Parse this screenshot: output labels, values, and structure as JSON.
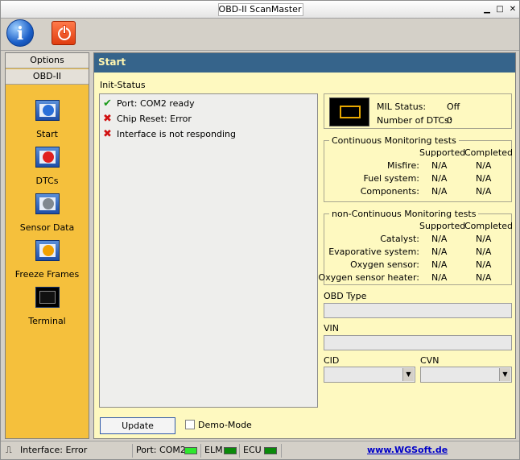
{
  "window": {
    "title": "OBD-II ScanMaster",
    "minimize": "▁",
    "maximize": "□",
    "close": "✕"
  },
  "toolbar": {
    "info_icon": "info-icon",
    "power_icon": "power-icon"
  },
  "sidebar": {
    "tabs": [
      "Options",
      "OBD-II"
    ],
    "items": [
      {
        "label": "Start",
        "icon": "start-info-icon",
        "color": "#2a6fd8"
      },
      {
        "label": "DTCs",
        "icon": "dtc-error-icon",
        "color": "#e02020"
      },
      {
        "label": "Sensor Data",
        "icon": "gear-icon",
        "color": "#808890"
      },
      {
        "label": "Freeze Frames",
        "icon": "freeze-icon",
        "color": "#f0a000"
      },
      {
        "label": "Terminal",
        "icon": "terminal-icon",
        "color": "#000000"
      }
    ]
  },
  "main": {
    "title": "Start",
    "init_status_label": "Init-Status",
    "status_lines": [
      {
        "ok": true,
        "text": "Port: COM2 ready"
      },
      {
        "ok": false,
        "text": "Chip Reset: Error"
      },
      {
        "ok": false,
        "text": "Interface is not responding"
      }
    ],
    "mil": {
      "status_label": "MIL Status:",
      "status_value": "Off",
      "dtc_label": "Number of DTCs:",
      "dtc_value": "0"
    },
    "continuous": {
      "title": "Continuous Monitoring tests",
      "col_supported": "Supported",
      "col_completed": "Completed",
      "rows": [
        {
          "name": "Misfire:",
          "supported": "N/A",
          "completed": "N/A"
        },
        {
          "name": "Fuel system:",
          "supported": "N/A",
          "completed": "N/A"
        },
        {
          "name": "Components:",
          "supported": "N/A",
          "completed": "N/A"
        }
      ]
    },
    "non_continuous": {
      "title": "non-Continuous Monitoring tests",
      "col_supported": "Supported",
      "col_completed": "Completed",
      "rows": [
        {
          "name": "Catalyst:",
          "supported": "N/A",
          "completed": "N/A"
        },
        {
          "name": "Evaporative system:",
          "supported": "N/A",
          "completed": "N/A"
        },
        {
          "name": "Oxygen sensor:",
          "supported": "N/A",
          "completed": "N/A"
        },
        {
          "name": "Oxygen sensor heater:",
          "supported": "N/A",
          "completed": "N/A"
        }
      ]
    },
    "obd_type_label": "OBD Type",
    "obd_type_value": "",
    "vin_label": "VIN",
    "vin_value": "",
    "cid_label": "CID",
    "cvn_label": "CVN",
    "update_button": "Update",
    "demo_mode_label": "Demo-Mode"
  },
  "statusbar": {
    "interface": "Interface: Error",
    "port": "Port: COM2",
    "elm": "ELM",
    "ecu": "ECU",
    "link": "www.WGSoft.de",
    "port_led": "#2ee82e",
    "elm_led": "#0a8a0a",
    "ecu_led": "#0a8a0a"
  }
}
